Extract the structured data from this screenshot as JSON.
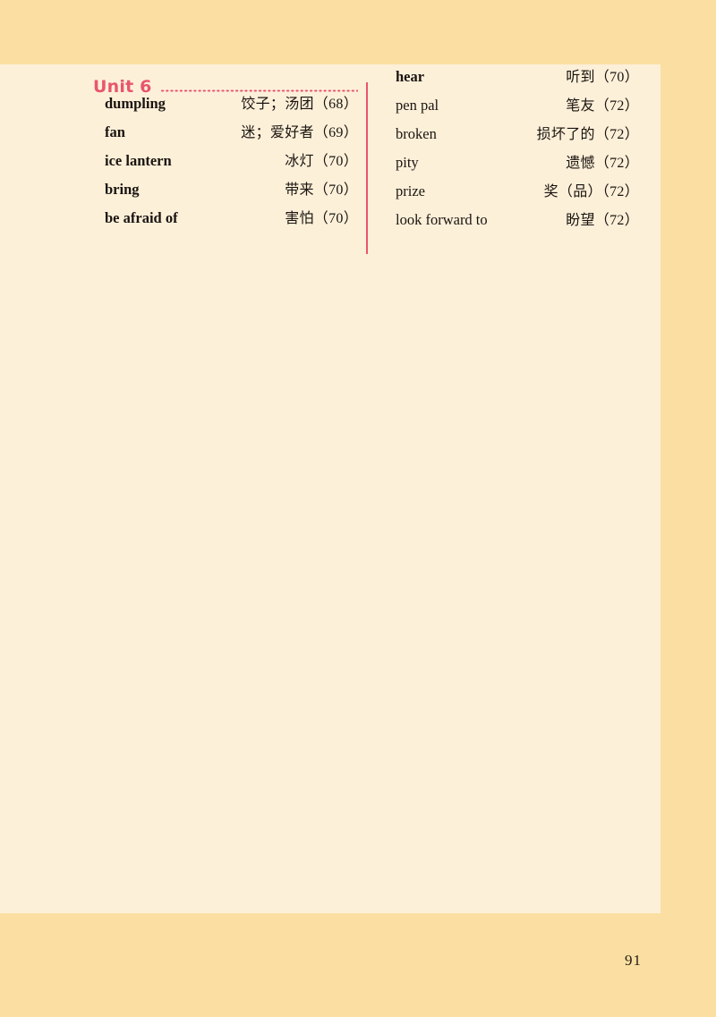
{
  "colors": {
    "outer_band": "#FBDFA2",
    "page_sheet": "#FDF0D9",
    "accent_pink": "#E8556E",
    "body_text": "#1A1410"
  },
  "heading": {
    "unit_label": "Unit 6"
  },
  "left_column": [
    {
      "term": "dumpling",
      "bold": true,
      "gloss": "饺子；汤团（68）"
    },
    {
      "term": "fan",
      "bold": true,
      "gloss": "迷；爱好者（69）"
    },
    {
      "term": "ice lantern",
      "bold": true,
      "gloss": "冰灯（70）"
    },
    {
      "term": "bring",
      "bold": true,
      "gloss": "带来（70）"
    },
    {
      "term": "be afraid of",
      "bold": true,
      "gloss": "害怕（70）"
    }
  ],
  "right_column": [
    {
      "term": "hear",
      "bold": true,
      "gloss": "听到（70）"
    },
    {
      "term": "pen pal",
      "bold": false,
      "gloss": "笔友（72）"
    },
    {
      "term": "broken",
      "bold": false,
      "gloss": "损坏了的（72）"
    },
    {
      "term": "pity",
      "bold": false,
      "gloss": "遗憾（72）"
    },
    {
      "term": "prize",
      "bold": false,
      "gloss": "奖（品）（72）"
    },
    {
      "term": "look forward to",
      "bold": false,
      "gloss": "盼望（72）"
    }
  ],
  "footer": {
    "page_number": "91"
  }
}
